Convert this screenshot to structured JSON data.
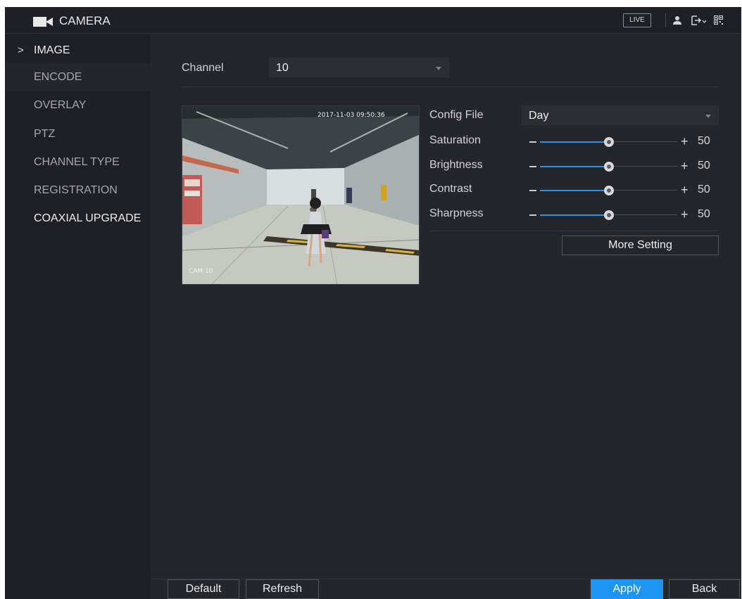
{
  "header": {
    "title": "CAMERA",
    "live_label": "LIVE",
    "icons": [
      "camera-icon",
      "user-icon",
      "logout-icon",
      "qr-code-icon"
    ]
  },
  "sidebar": {
    "items": [
      {
        "label": "IMAGE",
        "active": true
      },
      {
        "label": "ENCODE"
      },
      {
        "label": "OVERLAY"
      },
      {
        "label": "PTZ"
      },
      {
        "label": "CHANNEL TYPE"
      },
      {
        "label": "REGISTRATION"
      },
      {
        "label": "COAXIAL UPGRADE"
      }
    ],
    "active_marker": ">"
  },
  "channel": {
    "label": "Channel",
    "value": "10"
  },
  "preview": {
    "timestamp": "2017-11-03 09:50:36",
    "camera_name": "CAM 10"
  },
  "config_file": {
    "label": "Config File",
    "value": "Day"
  },
  "sliders": [
    {
      "label": "Saturation",
      "value": 50,
      "min": 0,
      "max": 100
    },
    {
      "label": "Brightness",
      "value": 50,
      "min": 0,
      "max": 100
    },
    {
      "label": "Contrast",
      "value": 50,
      "min": 0,
      "max": 100
    },
    {
      "label": "Sharpness",
      "value": 50,
      "min": 0,
      "max": 100
    }
  ],
  "slider_symbols": {
    "minus": "−",
    "plus": "+"
  },
  "more_setting_label": "More Setting",
  "footer": {
    "default_label": "Default",
    "refresh_label": "Refresh",
    "apply_label": "Apply",
    "back_label": "Back"
  },
  "colors": {
    "background": "#25262c",
    "sidebar": "#1f2025",
    "accent": "#1c94f2",
    "slider_fill": "#2e8fe6"
  }
}
